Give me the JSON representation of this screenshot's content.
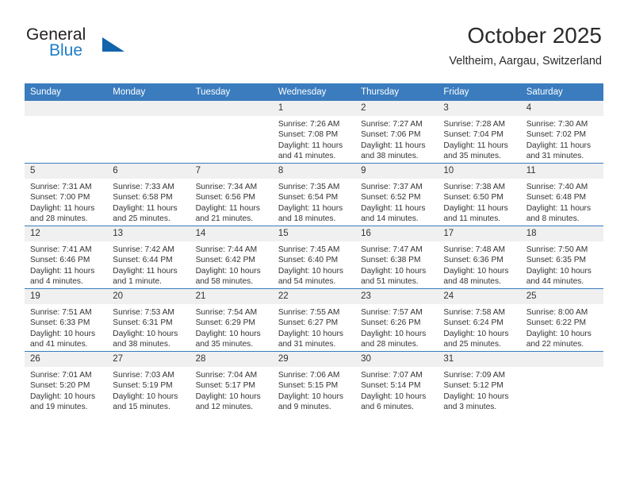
{
  "brand": {
    "name_part1": "General",
    "name_part2": "Blue",
    "logo_icon": "triangle-logo-icon"
  },
  "header": {
    "month_title": "October 2025",
    "location": "Veltheim, Aargau, Switzerland"
  },
  "colors": {
    "header_blue": "#3a7cbe",
    "brand_blue": "#1d7ec8",
    "logo_blue": "#1263ab",
    "daynum_bg": "#f0f0f0",
    "text": "#333333"
  },
  "calendar": {
    "weekday_headers": [
      "Sunday",
      "Monday",
      "Tuesday",
      "Wednesday",
      "Thursday",
      "Friday",
      "Saturday"
    ],
    "weeks": [
      [
        {
          "day": "",
          "blank": true,
          "sunrise": "",
          "sunset": "",
          "daylight_line1": "",
          "daylight_line2": ""
        },
        {
          "day": "",
          "blank": true,
          "sunrise": "",
          "sunset": "",
          "daylight_line1": "",
          "daylight_line2": ""
        },
        {
          "day": "",
          "blank": true,
          "sunrise": "",
          "sunset": "",
          "daylight_line1": "",
          "daylight_line2": ""
        },
        {
          "day": "1",
          "blank": false,
          "sunrise": "Sunrise: 7:26 AM",
          "sunset": "Sunset: 7:08 PM",
          "daylight_line1": "Daylight: 11 hours",
          "daylight_line2": "and 41 minutes."
        },
        {
          "day": "2",
          "blank": false,
          "sunrise": "Sunrise: 7:27 AM",
          "sunset": "Sunset: 7:06 PM",
          "daylight_line1": "Daylight: 11 hours",
          "daylight_line2": "and 38 minutes."
        },
        {
          "day": "3",
          "blank": false,
          "sunrise": "Sunrise: 7:28 AM",
          "sunset": "Sunset: 7:04 PM",
          "daylight_line1": "Daylight: 11 hours",
          "daylight_line2": "and 35 minutes."
        },
        {
          "day": "4",
          "blank": false,
          "sunrise": "Sunrise: 7:30 AM",
          "sunset": "Sunset: 7:02 PM",
          "daylight_line1": "Daylight: 11 hours",
          "daylight_line2": "and 31 minutes."
        }
      ],
      [
        {
          "day": "5",
          "blank": false,
          "sunrise": "Sunrise: 7:31 AM",
          "sunset": "Sunset: 7:00 PM",
          "daylight_line1": "Daylight: 11 hours",
          "daylight_line2": "and 28 minutes."
        },
        {
          "day": "6",
          "blank": false,
          "sunrise": "Sunrise: 7:33 AM",
          "sunset": "Sunset: 6:58 PM",
          "daylight_line1": "Daylight: 11 hours",
          "daylight_line2": "and 25 minutes."
        },
        {
          "day": "7",
          "blank": false,
          "sunrise": "Sunrise: 7:34 AM",
          "sunset": "Sunset: 6:56 PM",
          "daylight_line1": "Daylight: 11 hours",
          "daylight_line2": "and 21 minutes."
        },
        {
          "day": "8",
          "blank": false,
          "sunrise": "Sunrise: 7:35 AM",
          "sunset": "Sunset: 6:54 PM",
          "daylight_line1": "Daylight: 11 hours",
          "daylight_line2": "and 18 minutes."
        },
        {
          "day": "9",
          "blank": false,
          "sunrise": "Sunrise: 7:37 AM",
          "sunset": "Sunset: 6:52 PM",
          "daylight_line1": "Daylight: 11 hours",
          "daylight_line2": "and 14 minutes."
        },
        {
          "day": "10",
          "blank": false,
          "sunrise": "Sunrise: 7:38 AM",
          "sunset": "Sunset: 6:50 PM",
          "daylight_line1": "Daylight: 11 hours",
          "daylight_line2": "and 11 minutes."
        },
        {
          "day": "11",
          "blank": false,
          "sunrise": "Sunrise: 7:40 AM",
          "sunset": "Sunset: 6:48 PM",
          "daylight_line1": "Daylight: 11 hours",
          "daylight_line2": "and 8 minutes."
        }
      ],
      [
        {
          "day": "12",
          "blank": false,
          "sunrise": "Sunrise: 7:41 AM",
          "sunset": "Sunset: 6:46 PM",
          "daylight_line1": "Daylight: 11 hours",
          "daylight_line2": "and 4 minutes."
        },
        {
          "day": "13",
          "blank": false,
          "sunrise": "Sunrise: 7:42 AM",
          "sunset": "Sunset: 6:44 PM",
          "daylight_line1": "Daylight: 11 hours",
          "daylight_line2": "and 1 minute."
        },
        {
          "day": "14",
          "blank": false,
          "sunrise": "Sunrise: 7:44 AM",
          "sunset": "Sunset: 6:42 PM",
          "daylight_line1": "Daylight: 10 hours",
          "daylight_line2": "and 58 minutes."
        },
        {
          "day": "15",
          "blank": false,
          "sunrise": "Sunrise: 7:45 AM",
          "sunset": "Sunset: 6:40 PM",
          "daylight_line1": "Daylight: 10 hours",
          "daylight_line2": "and 54 minutes."
        },
        {
          "day": "16",
          "blank": false,
          "sunrise": "Sunrise: 7:47 AM",
          "sunset": "Sunset: 6:38 PM",
          "daylight_line1": "Daylight: 10 hours",
          "daylight_line2": "and 51 minutes."
        },
        {
          "day": "17",
          "blank": false,
          "sunrise": "Sunrise: 7:48 AM",
          "sunset": "Sunset: 6:36 PM",
          "daylight_line1": "Daylight: 10 hours",
          "daylight_line2": "and 48 minutes."
        },
        {
          "day": "18",
          "blank": false,
          "sunrise": "Sunrise: 7:50 AM",
          "sunset": "Sunset: 6:35 PM",
          "daylight_line1": "Daylight: 10 hours",
          "daylight_line2": "and 44 minutes."
        }
      ],
      [
        {
          "day": "19",
          "blank": false,
          "sunrise": "Sunrise: 7:51 AM",
          "sunset": "Sunset: 6:33 PM",
          "daylight_line1": "Daylight: 10 hours",
          "daylight_line2": "and 41 minutes."
        },
        {
          "day": "20",
          "blank": false,
          "sunrise": "Sunrise: 7:53 AM",
          "sunset": "Sunset: 6:31 PM",
          "daylight_line1": "Daylight: 10 hours",
          "daylight_line2": "and 38 minutes."
        },
        {
          "day": "21",
          "blank": false,
          "sunrise": "Sunrise: 7:54 AM",
          "sunset": "Sunset: 6:29 PM",
          "daylight_line1": "Daylight: 10 hours",
          "daylight_line2": "and 35 minutes."
        },
        {
          "day": "22",
          "blank": false,
          "sunrise": "Sunrise: 7:55 AM",
          "sunset": "Sunset: 6:27 PM",
          "daylight_line1": "Daylight: 10 hours",
          "daylight_line2": "and 31 minutes."
        },
        {
          "day": "23",
          "blank": false,
          "sunrise": "Sunrise: 7:57 AM",
          "sunset": "Sunset: 6:26 PM",
          "daylight_line1": "Daylight: 10 hours",
          "daylight_line2": "and 28 minutes."
        },
        {
          "day": "24",
          "blank": false,
          "sunrise": "Sunrise: 7:58 AM",
          "sunset": "Sunset: 6:24 PM",
          "daylight_line1": "Daylight: 10 hours",
          "daylight_line2": "and 25 minutes."
        },
        {
          "day": "25",
          "blank": false,
          "sunrise": "Sunrise: 8:00 AM",
          "sunset": "Sunset: 6:22 PM",
          "daylight_line1": "Daylight: 10 hours",
          "daylight_line2": "and 22 minutes."
        }
      ],
      [
        {
          "day": "26",
          "blank": false,
          "sunrise": "Sunrise: 7:01 AM",
          "sunset": "Sunset: 5:20 PM",
          "daylight_line1": "Daylight: 10 hours",
          "daylight_line2": "and 19 minutes."
        },
        {
          "day": "27",
          "blank": false,
          "sunrise": "Sunrise: 7:03 AM",
          "sunset": "Sunset: 5:19 PM",
          "daylight_line1": "Daylight: 10 hours",
          "daylight_line2": "and 15 minutes."
        },
        {
          "day": "28",
          "blank": false,
          "sunrise": "Sunrise: 7:04 AM",
          "sunset": "Sunset: 5:17 PM",
          "daylight_line1": "Daylight: 10 hours",
          "daylight_line2": "and 12 minutes."
        },
        {
          "day": "29",
          "blank": false,
          "sunrise": "Sunrise: 7:06 AM",
          "sunset": "Sunset: 5:15 PM",
          "daylight_line1": "Daylight: 10 hours",
          "daylight_line2": "and 9 minutes."
        },
        {
          "day": "30",
          "blank": false,
          "sunrise": "Sunrise: 7:07 AM",
          "sunset": "Sunset: 5:14 PM",
          "daylight_line1": "Daylight: 10 hours",
          "daylight_line2": "and 6 minutes."
        },
        {
          "day": "31",
          "blank": false,
          "sunrise": "Sunrise: 7:09 AM",
          "sunset": "Sunset: 5:12 PM",
          "daylight_line1": "Daylight: 10 hours",
          "daylight_line2": "and 3 minutes."
        },
        {
          "day": "",
          "blank": true,
          "sunrise": "",
          "sunset": "",
          "daylight_line1": "",
          "daylight_line2": ""
        }
      ]
    ]
  }
}
